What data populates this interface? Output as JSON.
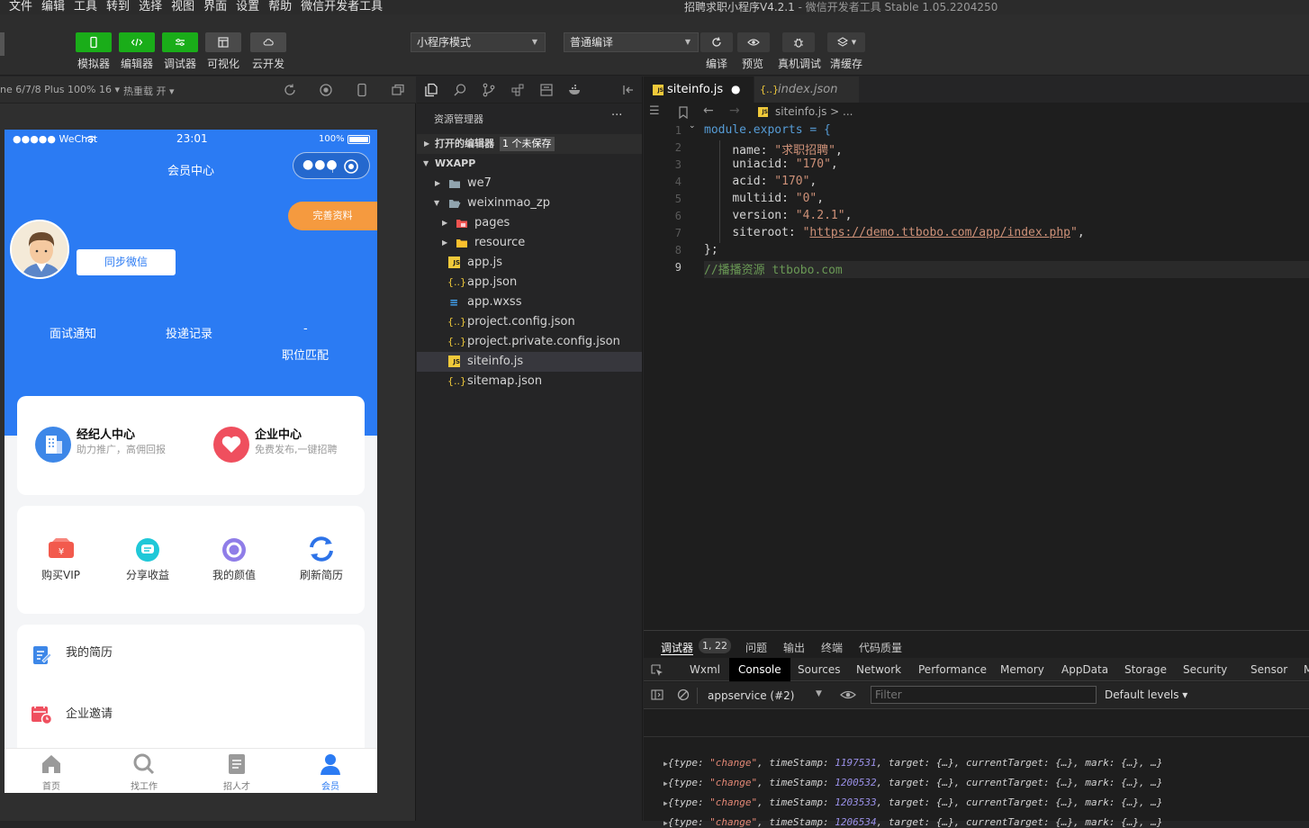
{
  "menubar": [
    "文件",
    "编辑",
    "工具",
    "转到",
    "选择",
    "视图",
    "界面",
    "设置",
    "帮助",
    "微信开发者工具"
  ],
  "window_title": "招聘求职小程序V4.2.1",
  "window_title_suffix": "- 微信开发者工具 Stable 1.05.2204250",
  "toolbar": {
    "left_buttons": [
      "模拟器",
      "编辑器",
      "调试器",
      "可视化",
      "云开发"
    ],
    "mode_select": "小程序模式",
    "compile_select": "普通编译",
    "right_buttons": [
      "编译",
      "预览",
      "真机调试",
      "清缓存"
    ]
  },
  "simulator": {
    "device": "ne 6/7/8 Plus 100% 16 ▾",
    "hot_reload": "热重载 开 ▾"
  },
  "phone": {
    "carrier": "●●●●● WeChat",
    "time": "23:01",
    "battery": "100%",
    "nav_title": "会员中心",
    "complete_profile": "完善资料",
    "sync_wechat": "同步微信",
    "stats": [
      "面试通知",
      "投递记录",
      "职位匹配"
    ],
    "stat_value": "-",
    "centers": [
      {
        "title": "经纪人中心",
        "sub": "助力推广，高佣回报"
      },
      {
        "title": "企业中心",
        "sub": "免费发布,一键招聘"
      }
    ],
    "quick_actions": [
      "购买VIP",
      "分享收益",
      "我的颜值",
      "刷新简历"
    ],
    "list": [
      "我的简历",
      "企业邀请"
    ],
    "tabbar": [
      "首页",
      "找工作",
      "招人才",
      "会员"
    ],
    "colors": {
      "primary": "#2b7bf3",
      "orange": "#f59a3f"
    }
  },
  "explorer": {
    "title": "资源管理器",
    "more": "···",
    "open_editors": "打开的编辑器",
    "unsaved": "1 个未保存",
    "root": "WXAPP",
    "items": [
      {
        "label": "we7",
        "kind": "folder"
      },
      {
        "label": "weixinmao_zp",
        "kind": "folder-open"
      },
      {
        "label": "pages",
        "kind": "folder-red"
      },
      {
        "label": "resource",
        "kind": "folder-yellow"
      },
      {
        "label": "app.js",
        "kind": "js"
      },
      {
        "label": "app.json",
        "kind": "json"
      },
      {
        "label": "app.wxss",
        "kind": "css"
      },
      {
        "label": "project.config.json",
        "kind": "json"
      },
      {
        "label": "project.private.config.json",
        "kind": "json"
      },
      {
        "label": "siteinfo.js",
        "kind": "js"
      },
      {
        "label": "sitemap.json",
        "kind": "json"
      }
    ]
  },
  "editor": {
    "tabs": [
      "siteinfo.js",
      "index.json"
    ],
    "breadcrumb": "siteinfo.js > ...",
    "lines": [
      "1",
      "2",
      "3",
      "4",
      "5",
      "6",
      "7",
      "8",
      "9"
    ],
    "code": {
      "l1": "module.exports = {",
      "l2_key": "name: ",
      "l2_val": "\"求职招聘\"",
      "l3_key": "uniacid: ",
      "l3_val": "\"170\"",
      "l4_key": "acid: ",
      "l4_val": "\"170\"",
      "l5_key": "multiid: ",
      "l5_val": "\"0\"",
      "l6_key": "version: ",
      "l6_val": "\"4.2.1\"",
      "l7_key": "siteroot: ",
      "l7_url": "https://demo.ttbobo.com/app/index.php",
      "l8": "};",
      "l9": "//播播资源 ttbobo.com"
    }
  },
  "devtools": {
    "tabs": [
      "调试器",
      "问题",
      "输出",
      "终端",
      "代码质量"
    ],
    "badge": "1, 22",
    "panels": [
      "Wxml",
      "Console",
      "Sources",
      "Network",
      "Performance",
      "Memory",
      "AppData",
      "Storage",
      "Security",
      "Sensor",
      "M"
    ],
    "context": "appservice (#2)",
    "filter_placeholder": "Filter",
    "levels": "Default levels ▾",
    "logs": [
      {
        "ts": "1197531"
      },
      {
        "ts": "1200532"
      },
      {
        "ts": "1203533"
      },
      {
        "ts": "1206534"
      }
    ],
    "log_type": "\"change\""
  }
}
